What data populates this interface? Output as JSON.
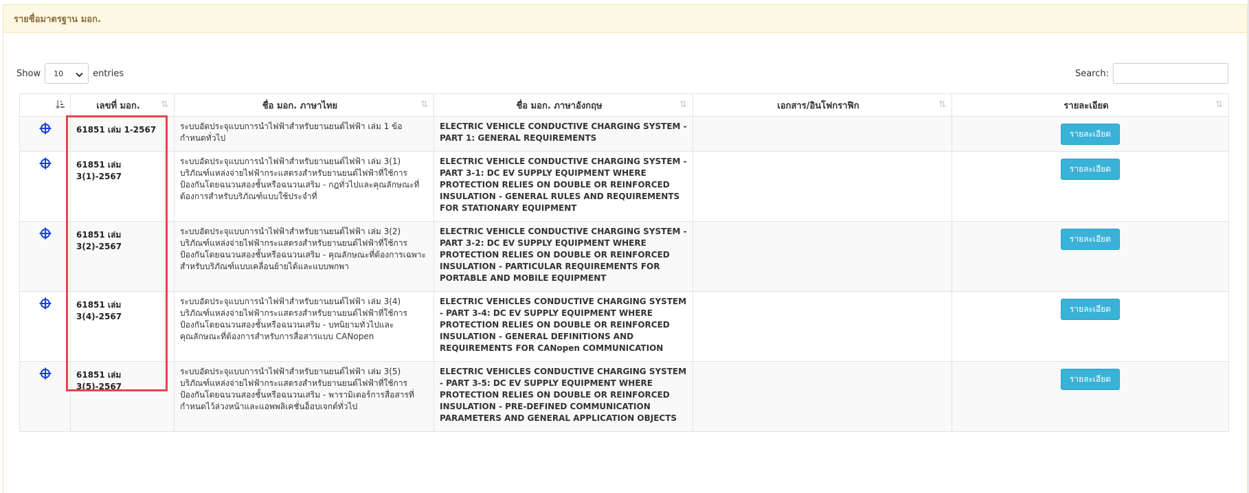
{
  "panel": {
    "title": "รายชื่อมาตรฐาน มอก."
  },
  "length_menu": {
    "prefix": "Show",
    "selected": "10",
    "suffix": "entries"
  },
  "search": {
    "label": "Search:",
    "value": ""
  },
  "columns": [
    {
      "label": ""
    },
    {
      "label": "เลขที่ มอก."
    },
    {
      "label": "ชื่อ มอก. ภาษาไทย"
    },
    {
      "label": "ชื่อ มอก. ภาษาอังกฤษ"
    },
    {
      "label": "เอกสาร/อินโฟกราฟิก"
    },
    {
      "label": "รายละเอียด"
    }
  ],
  "rows": [
    {
      "number": "61851 เล่ม 1-2567",
      "name_th": "ระบบอัดประจุแบบการนำไฟฟ้าสำหรับยานยนต์ไฟฟ้า เล่ม 1 ข้อกำหนดทั่วไป",
      "name_en": "ELECTRIC VEHICLE CONDUCTIVE CHARGING SYSTEM - PART 1: GENERAL REQUIREMENTS",
      "documents": "",
      "detail_label": "รายละเอียด"
    },
    {
      "number": "61851 เล่ม 3(1)-2567",
      "name_th": "ระบบอัดประจุแบบการนำไฟฟ้าสำหรับยานยนต์ไฟฟ้า เล่ม 3(1) บริภัณฑ์แหล่งจ่ายไฟฟ้ากระแสตรงสำหรับยานยนต์ไฟฟ้าที่ใช้การป้องกันโดยฉนวนสองชั้นหรือฉนวนเสริม - กฎทั่วไปและคุณลักษณะที่ต้องการสำหรับบริภัณฑ์แบบใช้ประจำที่",
      "name_en": "ELECTRIC VEHICLE CONDUCTIVE CHARGING SYSTEM - PART 3-1: DC EV SUPPLY EQUIPMENT WHERE PROTECTION RELIES ON DOUBLE OR REINFORCED INSULATION - GENERAL RULES AND REQUIREMENTS FOR STATIONARY EQUIPMENT",
      "documents": "",
      "detail_label": "รายละเอียด"
    },
    {
      "number": "61851 เล่ม 3(2)-2567",
      "name_th": "ระบบอัดประจุแบบการนำไฟฟ้าสำหรับยานยนต์ไฟฟ้า เล่ม 3(2) บริภัณฑ์แหล่งจ่ายไฟฟ้ากระแสตรงสำหรับยานยนต์ไฟฟ้าที่ใช้การป้องกันโดยฉนวนสองชั้นหรือฉนวนเสริม - คุณลักษณะที่ต้องการเฉพาะสำหรับบริภัณฑ์แบบเคลื่อนย้ายได้และแบบพกพา",
      "name_en": "ELECTRIC VEHICLE CONDUCTIVE CHARGING SYSTEM - PART 3-2: DC EV SUPPLY EQUIPMENT WHERE PROTECTION RELIES ON DOUBLE OR REINFORCED INSULATION - PARTICULAR REQUIREMENTS FOR PORTABLE AND MOBILE EQUIPMENT",
      "documents": "",
      "detail_label": "รายละเอียด"
    },
    {
      "number": "61851 เล่ม 3(4)-2567",
      "name_th": "ระบบอัดประจุแบบการนำไฟฟ้าสำหรับยานยนต์ไฟฟ้า เล่ม 3(4) บริภัณฑ์แหล่งจ่ายไฟฟ้ากระแสตรงสำหรับยานยนต์ไฟฟ้าที่ใช้การป้องกันโดยฉนวนสองชั้นหรือฉนวนเสริม - บทนิยามทั่วไปและคุณลักษณะที่ต้องการสำหรับการสื่อสารแบบ CANopen",
      "name_en": "ELECTRIC VEHICLES CONDUCTIVE CHARGING SYSTEM - PART 3-4: DC EV SUPPLY EQUIPMENT WHERE PROTECTION RELIES ON DOUBLE OR REINFORCED INSULATION - GENERAL DEFINITIONS AND REQUIREMENTS FOR CANopen COMMUNICATION",
      "documents": "",
      "detail_label": "รายละเอียด"
    },
    {
      "number": "61851 เล่ม 3(5)-2567",
      "name_th": "ระบบอัดประจุแบบการนำไฟฟ้าสำหรับยานยนต์ไฟฟ้า เล่ม 3(5) บริภัณฑ์แหล่งจ่ายไฟฟ้ากระแสตรงสำหรับยานยนต์ไฟฟ้าที่ใช้การป้องกันโดยฉนวนสองชั้นหรือฉนวนเสริม - พารามิเตอร์การสื่อสารที่กำหนดไว้ล่วงหน้าและแอพพลิเคชั่นอ็อบเจกต์ทั่วไป",
      "name_en": "ELECTRIC VEHICLES CONDUCTIVE CHARGING SYSTEM - PART 3-5: DC EV SUPPLY EQUIPMENT WHERE PROTECTION RELIES ON DOUBLE OR REINFORCED INSULATION - PRE-DEFINED COMMUNICATION PARAMETERS AND GENERAL APPLICATION OBJECTS",
      "documents": "",
      "detail_label": "รายละเอียด"
    }
  ],
  "colors": {
    "panel_heading_bg": "#fcf8e3",
    "panel_heading_text": "#8a6d3b",
    "detail_button": "#3ab2d8",
    "expand_icon": "#1a3fd8",
    "highlight_box": "#e0474c"
  },
  "icons": {
    "expand": "crosshair-expand-icon",
    "sort": "sort-arrows-icon",
    "sort_active": "sort-ascending-icon",
    "select_chevron": "chevron-down-icon"
  }
}
